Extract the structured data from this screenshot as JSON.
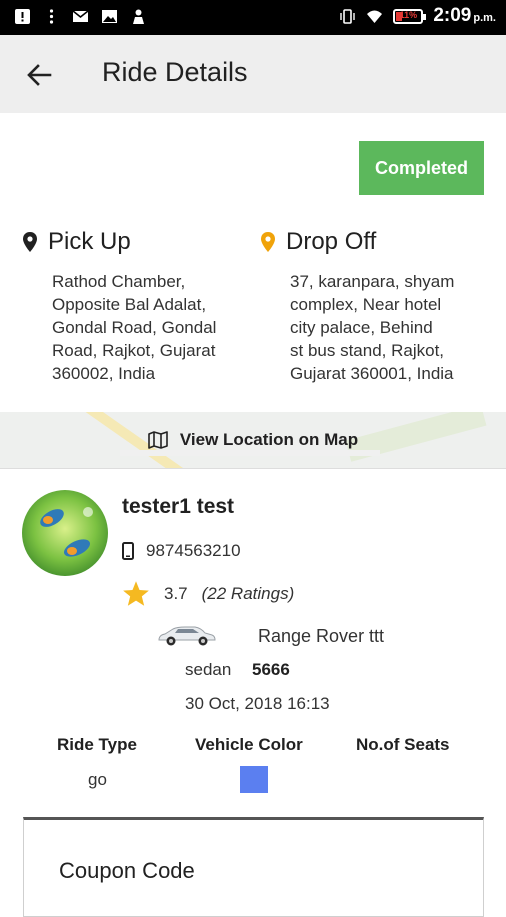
{
  "status_bar": {
    "time": "2:09",
    "ampm": "p.m.",
    "battery": "11%"
  },
  "app_bar": {
    "title": "Ride Details",
    "back_icon": "arrow-left-icon"
  },
  "status": {
    "label": "Completed",
    "color": "#5cb85c"
  },
  "pickup": {
    "label": "Pick Up",
    "address": "Rathod Chamber, Opposite Bal Adalat, Gondal Road, Gondal Road, Rajkot, Gujarat 360002, India",
    "address_lines": [
      "Rathod Chamber,",
      "Opposite Bal Adalat,",
      "Gondal Road, Gondal",
      "Road, Rajkot, Gujarat",
      "360002, India"
    ],
    "icon_color": "#212121"
  },
  "dropoff": {
    "label": "Drop Off",
    "address_lines": [
      "37, karanpara, shyam",
      "complex, Near hotel",
      "city palace, Behind",
      "st bus stand, Rajkot,",
      "Gujarat 360001, India"
    ],
    "icon_color": "#f0a30a"
  },
  "map_button": {
    "label": "View Location on Map"
  },
  "driver": {
    "name": "tester1 test",
    "phone": "9874563210",
    "rating": "3.7",
    "rating_count": "(22 Ratings)",
    "car_name": "Range Rover ttt",
    "car_type": "sedan",
    "plate": "5666",
    "date": "30 Oct, 2018 16:13"
  },
  "details": {
    "ride_type_label": "Ride Type",
    "vehicle_color_label": "Vehicle Color",
    "seats_label": "No.of Seats",
    "ride_type_value": "go",
    "vehicle_color": "#5b7ff0"
  },
  "coupon": {
    "label": "Coupon Code"
  }
}
